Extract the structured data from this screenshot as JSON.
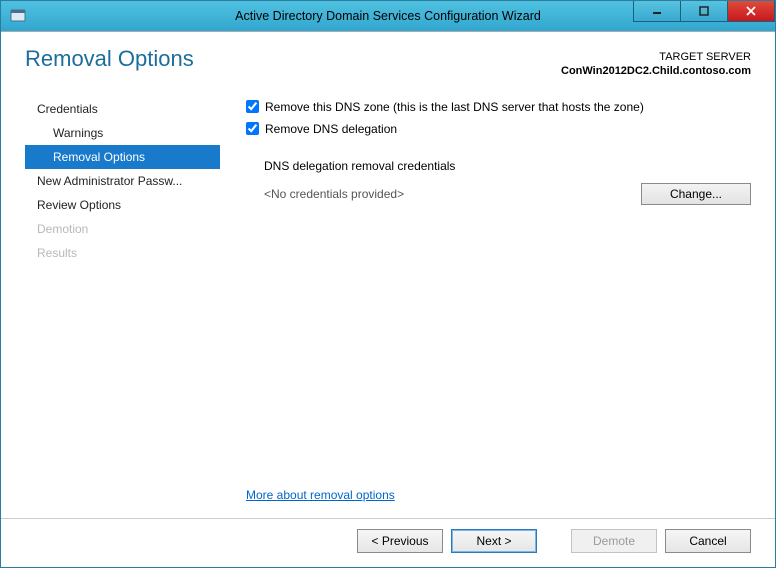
{
  "window": {
    "title": "Active Directory Domain Services Configuration Wizard"
  },
  "header": {
    "page_title": "Removal Options",
    "target_label": "TARGET SERVER",
    "target_server": "ConWin2012DC2.Child.contoso.com"
  },
  "nav": {
    "items": [
      {
        "label": "Credentials",
        "sub": false,
        "selected": false,
        "disabled": false
      },
      {
        "label": "Warnings",
        "sub": true,
        "selected": false,
        "disabled": false
      },
      {
        "label": "Removal Options",
        "sub": true,
        "selected": true,
        "disabled": false
      },
      {
        "label": "New Administrator Passw...",
        "sub": false,
        "selected": false,
        "disabled": false
      },
      {
        "label": "Review Options",
        "sub": false,
        "selected": false,
        "disabled": false
      },
      {
        "label": "Demotion",
        "sub": false,
        "selected": false,
        "disabled": true
      },
      {
        "label": "Results",
        "sub": false,
        "selected": false,
        "disabled": true
      }
    ]
  },
  "options": {
    "remove_zone": {
      "label": "Remove this DNS zone (this is the last DNS server that hosts the zone)",
      "checked": true
    },
    "remove_delegation": {
      "label": "Remove DNS delegation",
      "checked": true
    },
    "delegation_creds_label": "DNS delegation removal credentials",
    "credentials_text": "<No credentials provided>",
    "change_button": "Change..."
  },
  "links": {
    "more": "More about removal options"
  },
  "footer": {
    "previous": "< Previous",
    "next": "Next >",
    "demote": "Demote",
    "cancel": "Cancel"
  }
}
